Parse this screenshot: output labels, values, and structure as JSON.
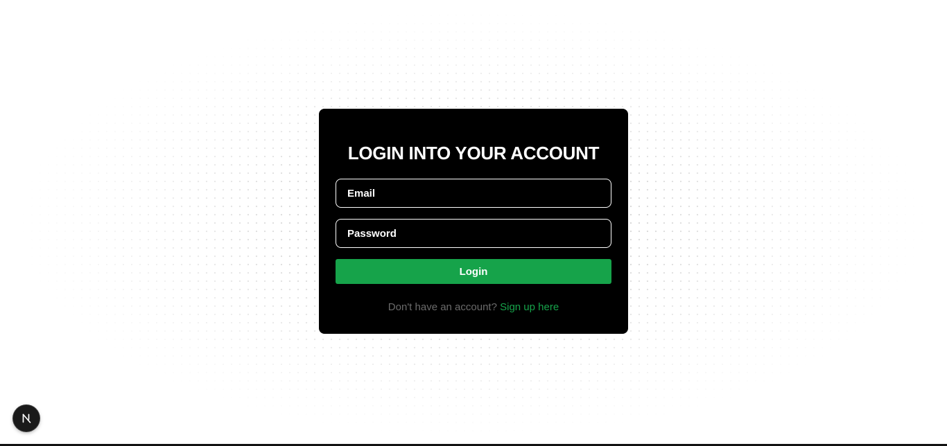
{
  "login_card": {
    "title": "LOGIN INTO YOUR ACCOUNT",
    "email_placeholder": "Email",
    "email_value": "",
    "password_placeholder": "Password",
    "password_value": "",
    "login_label": "Login",
    "signup_prompt": "Don't have an account? ",
    "signup_link": "Sign up here"
  },
  "dev_badge": {
    "icon": "nextjs-logo-icon"
  },
  "colors": {
    "card_bg": "#000000",
    "accent_green": "#16a34a",
    "muted_text": "#6b6b6b",
    "page_bg": "#ffffff"
  }
}
